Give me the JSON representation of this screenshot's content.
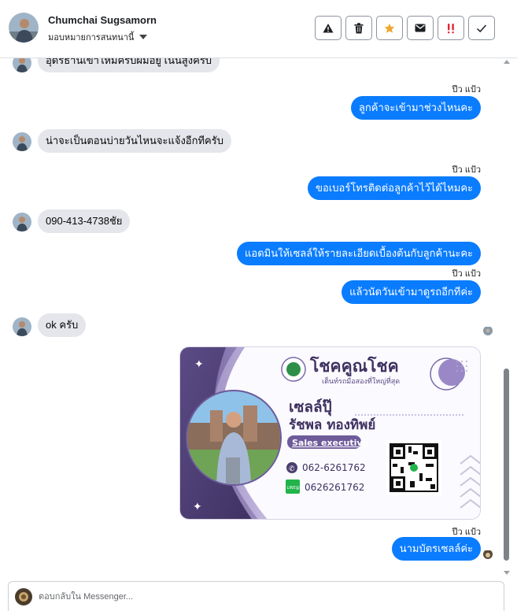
{
  "header": {
    "contact_name": "Chumchai Sugsamorn",
    "assign_label": "มอบหมายการสนทนานี้",
    "actions": [
      {
        "name": "warning-icon",
        "color": "#1c1e21"
      },
      {
        "name": "trash-icon",
        "color": "#1c1e21"
      },
      {
        "name": "star-icon",
        "color": "#f0a630"
      },
      {
        "name": "envelope-icon",
        "color": "#1c1e21"
      },
      {
        "name": "double-exclamation-icon",
        "color": "#e0262f"
      },
      {
        "name": "checkmark-icon",
        "color": "#1c1e21"
      }
    ]
  },
  "messages": [
    {
      "dir": "in",
      "text": "อุดรธานีเข้าใหม่ครับผมอยู่ เนินสูงครับ"
    },
    {
      "dir": "out",
      "time": "ปีว แป้ว",
      "text": "ลูกค้าจะเข้ามาช่วงไหนคะ"
    },
    {
      "dir": "in",
      "text": "น่าจะเป็นตอนบ่ายวันไหนจะแจ้งอีกทีครับ"
    },
    {
      "dir": "out",
      "time": "ปีว แป้ว",
      "text": "ขอเบอร์โทรติดต่อลูกค้าไว้ได้ไหมคะ"
    },
    {
      "dir": "in",
      "text": "090-413-4738ชัย"
    },
    {
      "dir": "out",
      "text": "แอดมินให้เซลล์ให้รายละเอียดเบื้องต้นกับลูกค้านะคะ"
    },
    {
      "dir": "out",
      "time": "ปีว แป้ว",
      "text": "แล้วนัดวันเข้ามาดูรถอีกทีค่ะ"
    },
    {
      "dir": "in",
      "text": "ok ครับ"
    },
    {
      "dir": "out",
      "time": "ปีว แป้ว",
      "text": "นามบัตรเซลล์ค่ะ"
    }
  ],
  "business_card": {
    "brand": "โชคคูณโชค",
    "tagline": "เต็นท์รถมือสองที่ใหญ่ที่สุด",
    "nickname": "เซลล์ปุ๊",
    "full_name": "รัชพล ทองทิพย์",
    "position": "Sales executive",
    "phone": "062-6261762",
    "line_id": "0626261762",
    "line_badge": "LINE@"
  },
  "composer": {
    "placeholder": "ตอบกลับใน Messenger..."
  }
}
